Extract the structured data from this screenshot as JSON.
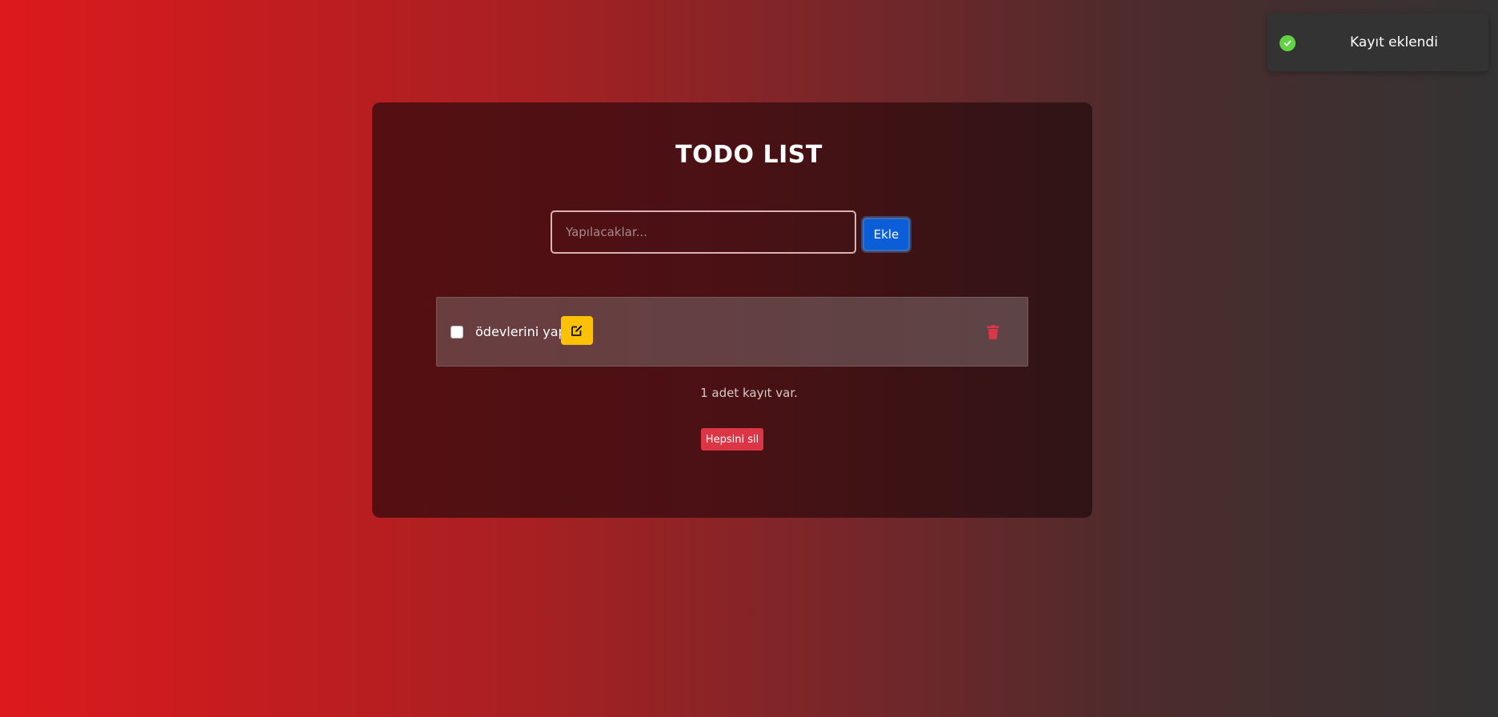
{
  "app": {
    "title": "TODO LIST"
  },
  "form": {
    "placeholder": "Yapılacaklar...",
    "value": "",
    "add_label": "Ekle"
  },
  "todos": [
    {
      "text": "ödevlerini yap",
      "checked": false
    }
  ],
  "footer": {
    "count_text": "1 adet kayıt var.",
    "delete_all_label": "Hepsini sil"
  },
  "toast": {
    "message": "Kayıt eklendi",
    "status": "success"
  },
  "icons": {
    "edit": "edit-icon",
    "trash": "trash-icon",
    "toast": "check-circle-icon"
  },
  "colors": {
    "add_button": "#0b5ed7",
    "edit_button": "#ffc107",
    "danger": "#dc3545",
    "success": "#61d345"
  }
}
